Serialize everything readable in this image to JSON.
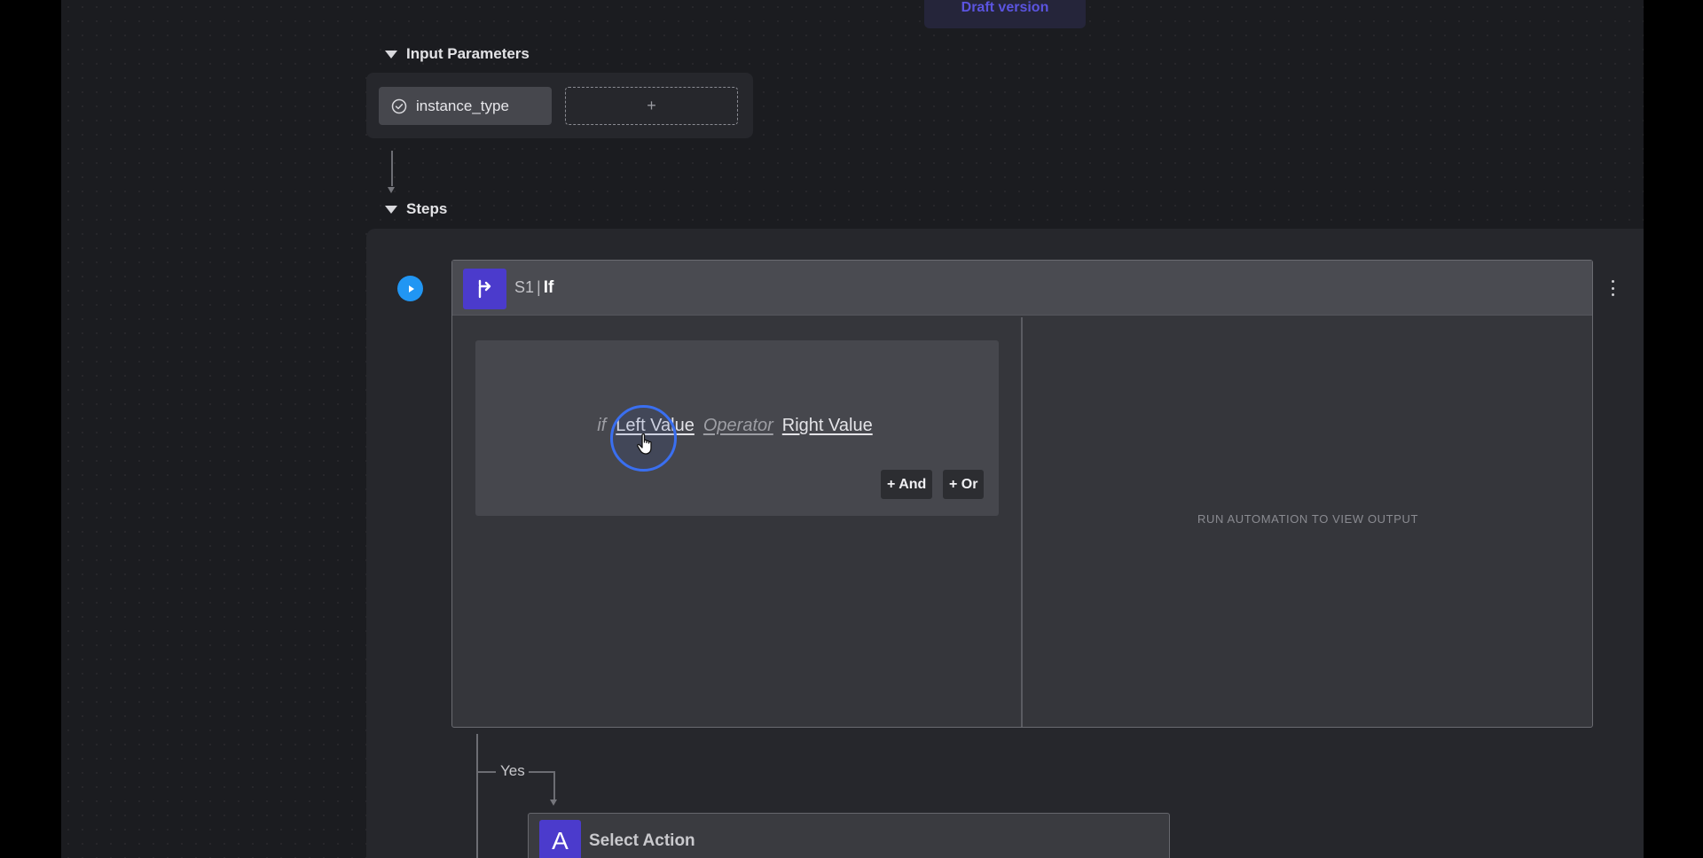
{
  "header": {
    "draft_badge": "Draft version"
  },
  "input_parameters": {
    "title": "Input Parameters",
    "params": [
      {
        "label": "instance_type",
        "icon": "check-circle-icon"
      }
    ],
    "add_label": "+"
  },
  "steps": {
    "title": "Steps",
    "step": {
      "id": "S1",
      "separator": "|",
      "name": "If",
      "icon": "branch-icon",
      "condition": {
        "keyword": "if",
        "left_value": "Left Value",
        "operator": "Operator",
        "right_value": "Right Value",
        "and_label": "+ And",
        "or_label": "+ Or"
      },
      "output_placeholder": "RUN AUTOMATION TO VIEW OUTPUT"
    },
    "branch": {
      "yes_label": "Yes"
    },
    "next_action": {
      "icon_letter": "A",
      "title": "Select Action"
    }
  },
  "colors": {
    "accent": "#4b3bcc",
    "run_button": "#2196f3",
    "cursor_ring": "#3a6ff0",
    "canvas": "#1b1c20"
  }
}
